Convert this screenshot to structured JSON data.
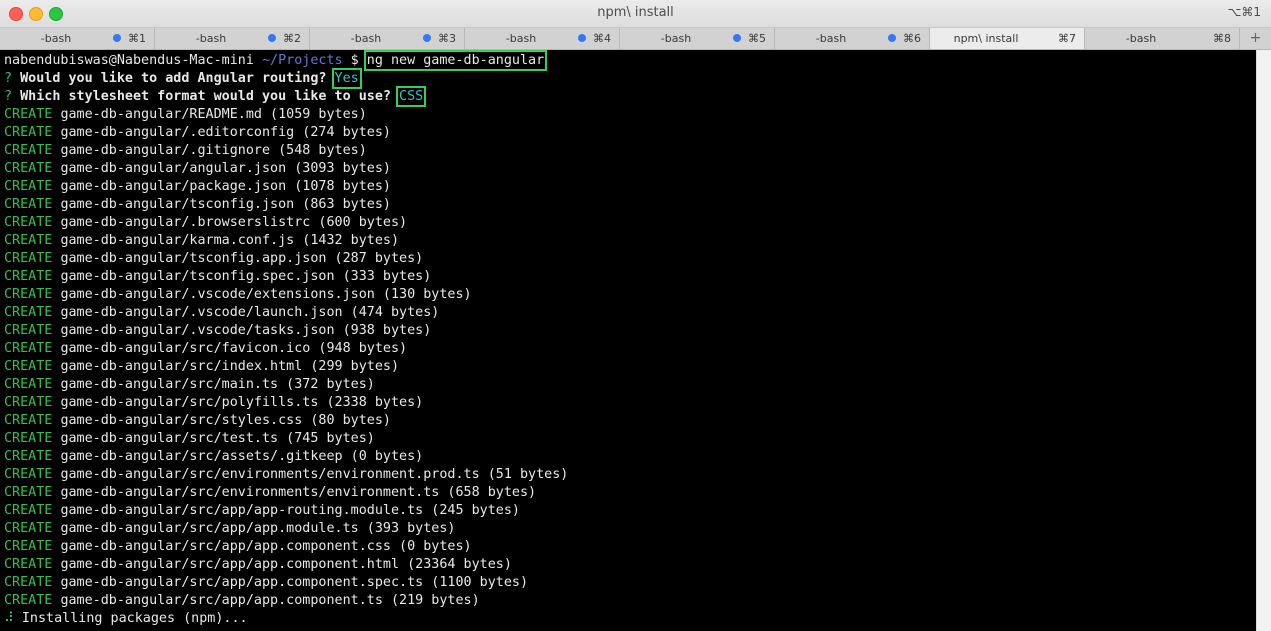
{
  "window": {
    "title": "npm\\ install",
    "shortcut": "⌥⌘1"
  },
  "tabs": [
    {
      "label": "-bash",
      "key": "⌘1",
      "dot": true,
      "active": false
    },
    {
      "label": "-bash",
      "key": "⌘2",
      "dot": true,
      "active": false
    },
    {
      "label": "-bash",
      "key": "⌘3",
      "dot": true,
      "active": false
    },
    {
      "label": "-bash",
      "key": "⌘4",
      "dot": true,
      "active": false
    },
    {
      "label": "-bash",
      "key": "⌘5",
      "dot": true,
      "active": false
    },
    {
      "label": "-bash",
      "key": "⌘6",
      "dot": true,
      "active": false
    },
    {
      "label": "npm\\ install",
      "key": "⌘7",
      "dot": false,
      "active": true
    },
    {
      "label": "-bash",
      "key": "⌘8",
      "dot": false,
      "active": false
    }
  ],
  "new_tab_label": "+",
  "prompt": {
    "user_host": "nabendubiswas@Nabendus-Mac-mini",
    "cwd": "~/Projects",
    "symbol": "$",
    "command": "ng new game-db-angular"
  },
  "questions": [
    {
      "marker": "?",
      "text": "Would you like to add Angular routing?",
      "answer": "Yes"
    },
    {
      "marker": "?",
      "text": "Which stylesheet format would you like to use?",
      "answer": "CSS"
    }
  ],
  "create_label": "CREATE",
  "created_files": [
    "game-db-angular/README.md (1059 bytes)",
    "game-db-angular/.editorconfig (274 bytes)",
    "game-db-angular/.gitignore (548 bytes)",
    "game-db-angular/angular.json (3093 bytes)",
    "game-db-angular/package.json (1078 bytes)",
    "game-db-angular/tsconfig.json (863 bytes)",
    "game-db-angular/.browserslistrc (600 bytes)",
    "game-db-angular/karma.conf.js (1432 bytes)",
    "game-db-angular/tsconfig.app.json (287 bytes)",
    "game-db-angular/tsconfig.spec.json (333 bytes)",
    "game-db-angular/.vscode/extensions.json (130 bytes)",
    "game-db-angular/.vscode/launch.json (474 bytes)",
    "game-db-angular/.vscode/tasks.json (938 bytes)",
    "game-db-angular/src/favicon.ico (948 bytes)",
    "game-db-angular/src/index.html (299 bytes)",
    "game-db-angular/src/main.ts (372 bytes)",
    "game-db-angular/src/polyfills.ts (2338 bytes)",
    "game-db-angular/src/styles.css (80 bytes)",
    "game-db-angular/src/test.ts (745 bytes)",
    "game-db-angular/src/assets/.gitkeep (0 bytes)",
    "game-db-angular/src/environments/environment.prod.ts (51 bytes)",
    "game-db-angular/src/environments/environment.ts (658 bytes)",
    "game-db-angular/src/app/app-routing.module.ts (245 bytes)",
    "game-db-angular/src/app/app.module.ts (393 bytes)",
    "game-db-angular/src/app/app.component.css (0 bytes)",
    "game-db-angular/src/app/app.component.html (23364 bytes)",
    "game-db-angular/src/app/app.component.spec.ts (1100 bytes)",
    "game-db-angular/src/app/app.component.ts (219 bytes)"
  ],
  "status": {
    "spinner": "⠼",
    "text": "Installing packages (npm)..."
  },
  "colors": {
    "highlight_box": "#30d158",
    "create": "#33c14a",
    "answer": "#2ec4c4",
    "cwd": "#6a74d0",
    "tab_dot": "#3478f6"
  }
}
